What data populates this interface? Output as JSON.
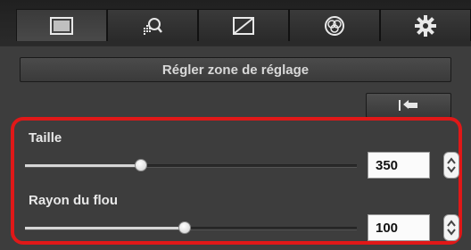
{
  "tabs": [
    {
      "icon": "display-icon",
      "active": true
    },
    {
      "icon": "area-target-icon",
      "active": false
    },
    {
      "icon": "tone-curve-icon",
      "active": false
    },
    {
      "icon": "color-circles-icon",
      "active": false
    },
    {
      "icon": "gear-icon",
      "active": false
    }
  ],
  "panel": {
    "set_area_label": "Régler zone de réglage",
    "undo_icon": "undo-icon"
  },
  "size": {
    "label": "Taille",
    "value": "350",
    "level": 0.35
  },
  "blur_radius": {
    "label": "Rayon du flou",
    "value": "100",
    "level": 0.48
  },
  "colors": {
    "highlight": "#e01818",
    "background": "#3d3d3d"
  }
}
